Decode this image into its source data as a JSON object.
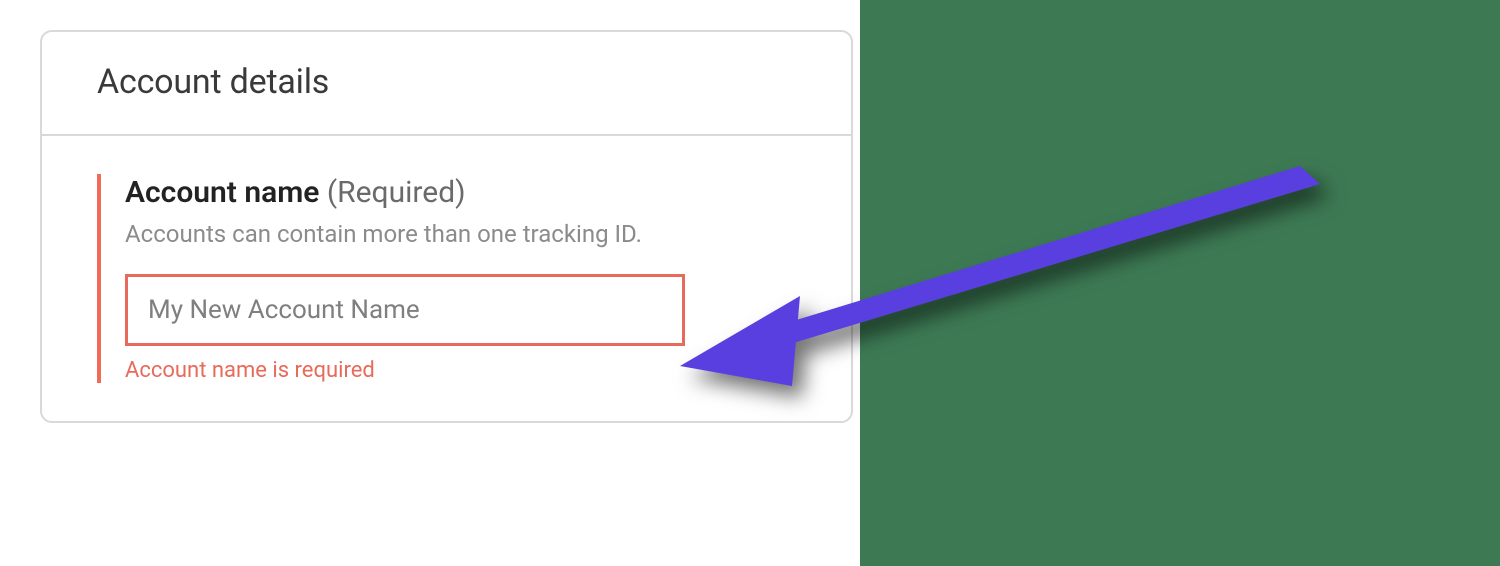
{
  "card": {
    "title": "Account details"
  },
  "field": {
    "label": "Account name",
    "required_suffix": "(Required)",
    "helper": "Accounts can contain more than one tracking ID.",
    "placeholder": "My New Account Name",
    "error": "Account name is required"
  },
  "colors": {
    "error": "#e86a5a",
    "accent_arrow": "#5a3fe0",
    "panel_green": "#3d7a54"
  }
}
